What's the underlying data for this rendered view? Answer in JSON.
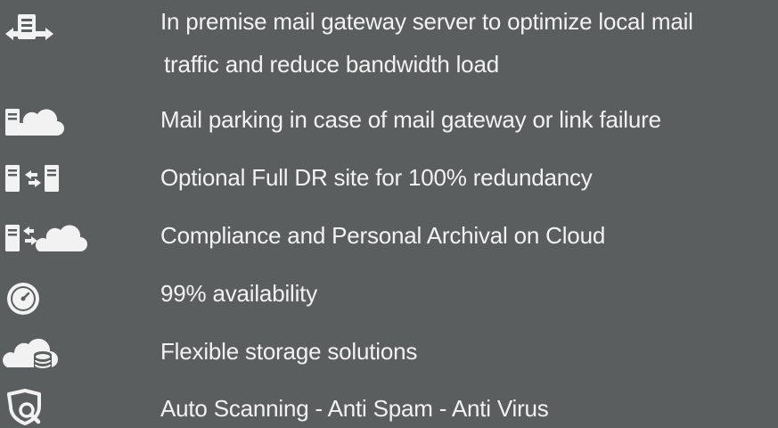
{
  "features": [
    {
      "icon": "server-exchange-icon",
      "line1": "In premise mail gateway server to optimize local mail",
      "line2": "traffic and reduce bandwidth load"
    },
    {
      "icon": "server-cloud-icon",
      "text": "Mail parking in case of mail gateway or link failure"
    },
    {
      "icon": "server-sync-icon",
      "text": "Optional Full DR site for 100% redundancy"
    },
    {
      "icon": "server-cloud-archive-icon",
      "text": "Compliance and Personal Archival on Cloud"
    },
    {
      "icon": "gauge-icon",
      "text": "99% availability"
    },
    {
      "icon": "cloud-storage-icon",
      "text": "Flexible storage solutions"
    },
    {
      "icon": "shield-scan-icon",
      "text": "Auto Scanning - Anti Spam - Anti Virus"
    }
  ],
  "colors": {
    "background": "#5b5e5e",
    "text": "#f2f2f2",
    "icon": "#f2f2f2"
  }
}
